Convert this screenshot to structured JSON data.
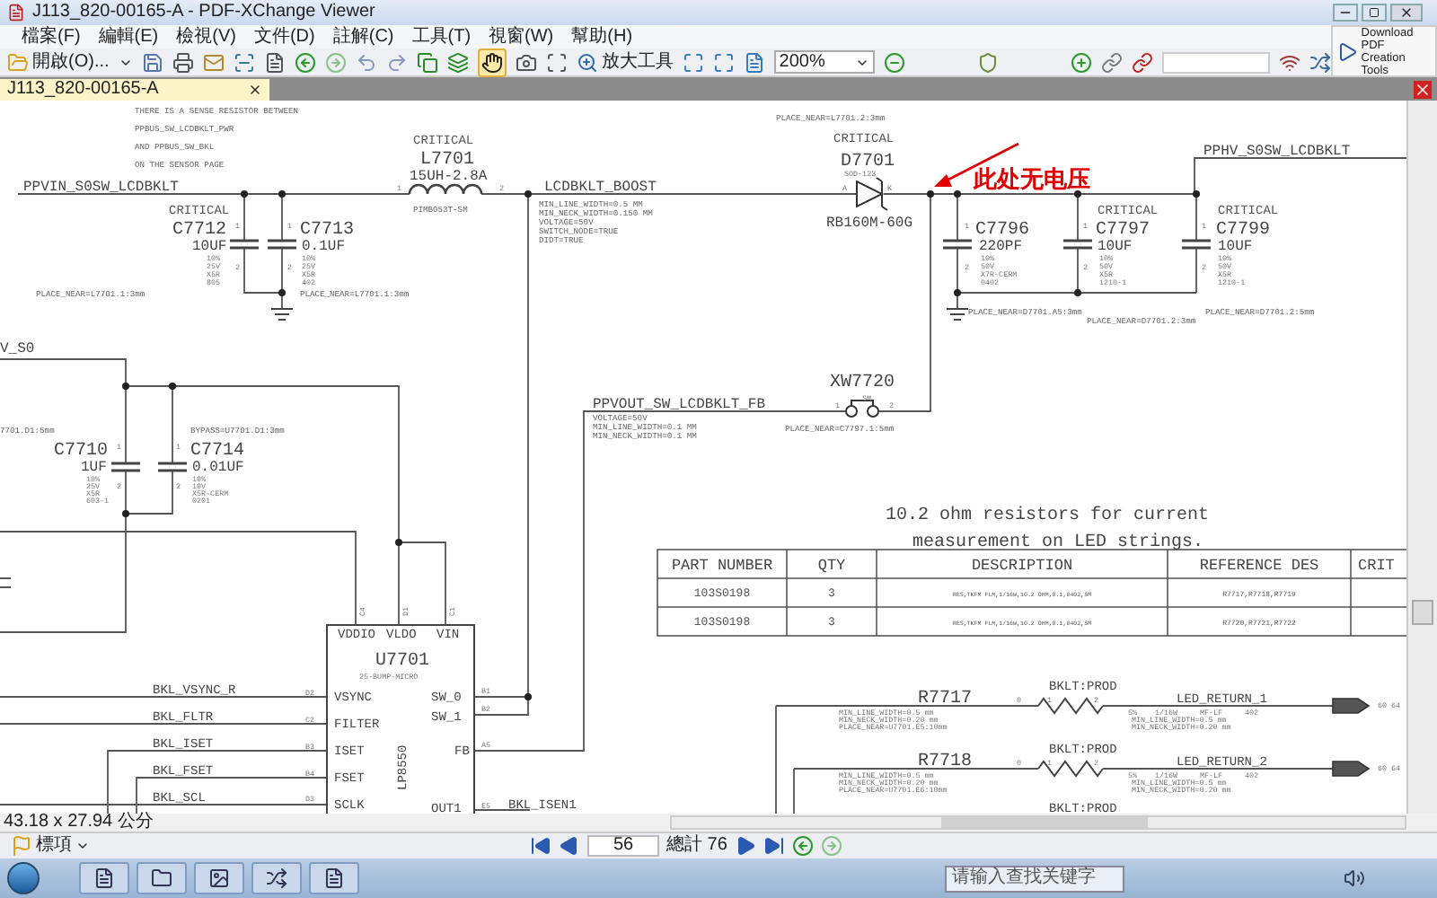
{
  "window": {
    "title": "J113_820-00165-A - PDF-XChange Viewer"
  },
  "menu": [
    "檔案(F)",
    "編輯(E)",
    "檢視(V)",
    "文件(D)",
    "註解(C)",
    "工具(T)",
    "視窗(W)",
    "幫助(H)"
  ],
  "download_button": {
    "label": "Download PDF Creation Tools"
  },
  "toolbar": {
    "open_label": "開啟(O)...",
    "zoom_tool_label": "放大工具",
    "zoom_value": "200%",
    "hand_tool": {
      "selected": true
    }
  },
  "tabs": [
    {
      "label": "J113_820-00165-A",
      "selected": true
    }
  ],
  "schematic": {
    "labels": [
      {
        "text": "THERE IS A SENSE RESISTOR BETWEEN",
        "kind": "note"
      },
      {
        "text": "PPBUS_SW_LCDBKLT_PWR",
        "kind": "note"
      },
      {
        "text": "AND PPBUS_SW_BKL",
        "kind": "note"
      },
      {
        "text": "ON THE SENSOR PAGE",
        "kind": "note"
      },
      {
        "text": "PPVIN_S0SW_LCDBKLT",
        "kind": "net"
      },
      {
        "text": "CRITICAL",
        "kind": "critical"
      },
      {
        "text": "L7701",
        "kind": "ref"
      },
      {
        "text": "15UH-2.8A",
        "kind": "value"
      },
      {
        "text": "1",
        "kind": "pin"
      },
      {
        "text": "2",
        "kind": "pin"
      },
      {
        "text": "PIMB053T-SM",
        "kind": "note"
      },
      {
        "text": "LCDBKLT_BOOST",
        "kind": "net"
      },
      {
        "text": "MIN_LINE_WIDTH=0.5 MM",
        "kind": "note"
      },
      {
        "text": "MIN_NECK_WIDTH=0.150 MM",
        "kind": "note"
      },
      {
        "text": "VOLTAGE=50V",
        "kind": "note"
      },
      {
        "text": "SWITCH_NODE=TRUE",
        "kind": "note"
      },
      {
        "text": "DIDT=TRUE",
        "kind": "note"
      },
      {
        "text": "CRITICAL",
        "kind": "critical"
      },
      {
        "text": "C7712",
        "kind": "ref"
      },
      {
        "text": "10UF",
        "kind": "value"
      },
      {
        "text": "1",
        "kind": "pin"
      },
      {
        "text": "2",
        "kind": "pin"
      },
      {
        "text": "10%",
        "kind": "spec"
      },
      {
        "text": "25V",
        "kind": "spec"
      },
      {
        "text": "X5R",
        "kind": "spec"
      },
      {
        "text": "805",
        "kind": "spec"
      },
      {
        "text": "C7713",
        "kind": "ref"
      },
      {
        "text": "0.1UF",
        "kind": "value"
      },
      {
        "text": "1",
        "kind": "pin"
      },
      {
        "text": "2",
        "kind": "pin"
      },
      {
        "text": "10%",
        "kind": "spec"
      },
      {
        "text": "25V",
        "kind": "spec"
      },
      {
        "text": "X5R",
        "kind": "spec"
      },
      {
        "text": "402",
        "kind": "spec"
      },
      {
        "text": "PLACE_NEAR=L7701.1:3mm",
        "kind": "note"
      },
      {
        "text": "PLACE_NEAR=L7701.1:3mm",
        "kind": "note"
      },
      {
        "text": "PLACE_NEAR=L7701.2:3mm",
        "kind": "note"
      },
      {
        "text": "CRITICAL",
        "kind": "critical"
      },
      {
        "text": "D7701",
        "kind": "ref"
      },
      {
        "text": "SOD-123",
        "kind": "spec"
      },
      {
        "text": "A",
        "kind": "pin"
      },
      {
        "text": "K",
        "kind": "pin"
      },
      {
        "text": "RB160M-60G",
        "kind": "value"
      },
      {
        "text": "此处无电压",
        "kind": "callout"
      },
      {
        "text": "PPHV_S0SW_LCDBKLT",
        "kind": "net"
      },
      {
        "text": "C7796",
        "kind": "ref"
      },
      {
        "text": "220PF",
        "kind": "value"
      },
      {
        "text": "1",
        "kind": "pin"
      },
      {
        "text": "2",
        "kind": "pin"
      },
      {
        "text": "10%",
        "kind": "spec"
      },
      {
        "text": "50V",
        "kind": "spec"
      },
      {
        "text": "X7R-CERM",
        "kind": "spec"
      },
      {
        "text": "0402",
        "kind": "spec"
      },
      {
        "text": "CRITICAL",
        "kind": "critical"
      },
      {
        "text": "C7797",
        "kind": "ref"
      },
      {
        "text": "10UF",
        "kind": "value"
      },
      {
        "text": "1",
        "kind": "pin"
      },
      {
        "text": "2",
        "kind": "pin"
      },
      {
        "text": "10%",
        "kind": "spec"
      },
      {
        "text": "50V",
        "kind": "spec"
      },
      {
        "text": "X5R",
        "kind": "spec"
      },
      {
        "text": "1210-1",
        "kind": "spec"
      },
      {
        "text": "CRITICAL",
        "kind": "critical"
      },
      {
        "text": "C7799",
        "kind": "ref"
      },
      {
        "text": "10UF",
        "kind": "value"
      },
      {
        "text": "1",
        "kind": "pin"
      },
      {
        "text": "2",
        "kind": "pin"
      },
      {
        "text": "10%",
        "kind": "spec"
      },
      {
        "text": "50V",
        "kind": "spec"
      },
      {
        "text": "X5R",
        "kind": "spec"
      },
      {
        "text": "1210-1",
        "kind": "spec"
      },
      {
        "text": "PLACE_NEAR=D7701.A5:3mm",
        "kind": "note"
      },
      {
        "text": "PLACE_NEAR=D7701.2:3mm",
        "kind": "note"
      },
      {
        "text": "PLACE_NEAR=D7701.2:5mm",
        "kind": "note"
      },
      {
        "text": "V_S0",
        "kind": "net"
      },
      {
        "text": "XW7720",
        "kind": "ref"
      },
      {
        "text": "SM",
        "kind": "spec"
      },
      {
        "text": "1",
        "kind": "pin"
      },
      {
        "text": "2",
        "kind": "pin"
      },
      {
        "text": "PLACE_NEAR=C7797.1:5mm",
        "kind": "note"
      },
      {
        "text": "PPVOUT_SW_LCDBKLT_FB",
        "kind": "net"
      },
      {
        "text": "VOLTAGE=50V",
        "kind": "note"
      },
      {
        "text": "MIN_LINE_WIDTH=0.1 MM",
        "kind": "note"
      },
      {
        "text": "MIN_NECK_WIDTH=0.1 MM",
        "kind": "note"
      },
      {
        "text": "7701.D1:5mm",
        "kind": "note"
      },
      {
        "text": "BYPASS=U7701.D1:3mm",
        "kind": "note"
      },
      {
        "text": "C7710",
        "kind": "ref"
      },
      {
        "text": "1UF",
        "kind": "value"
      },
      {
        "text": "1",
        "kind": "pin"
      },
      {
        "text": "2",
        "kind": "pin"
      },
      {
        "text": "10%",
        "kind": "spec"
      },
      {
        "text": "25V",
        "kind": "spec"
      },
      {
        "text": "X5R",
        "kind": "spec"
      },
      {
        "text": "603-1",
        "kind": "spec"
      },
      {
        "text": "C7714",
        "kind": "ref"
      },
      {
        "text": "0.01UF",
        "kind": "value"
      },
      {
        "text": "1",
        "kind": "pin"
      },
      {
        "text": "2",
        "kind": "pin"
      },
      {
        "text": "10%",
        "kind": "spec"
      },
      {
        "text": "10V",
        "kind": "spec"
      },
      {
        "text": "X5R-CERM",
        "kind": "spec"
      },
      {
        "text": "0201",
        "kind": "spec"
      },
      {
        "text": "10.2 ohm resistors for current",
        "kind": "heading"
      },
      {
        "text": "measurement on LED strings.",
        "kind": "heading"
      },
      {
        "text": "C4",
        "kind": "vpin"
      },
      {
        "text": "D1",
        "kind": "vpin"
      },
      {
        "text": "C1",
        "kind": "vpin"
      },
      {
        "text": "VDDIO",
        "kind": "port"
      },
      {
        "text": "VLDO",
        "kind": "port"
      },
      {
        "text": "VIN",
        "kind": "port"
      },
      {
        "text": "U7701",
        "kind": "ref"
      },
      {
        "text": "25-BUMP-MICRO",
        "kind": "spec"
      },
      {
        "text": "LP8550",
        "kind": "vertical"
      },
      {
        "text": "D2",
        "kind": "pin"
      },
      {
        "text": "C2",
        "kind": "pin"
      },
      {
        "text": "B3",
        "kind": "pin"
      },
      {
        "text": "B4",
        "kind": "pin"
      },
      {
        "text": "D3",
        "kind": "pin"
      },
      {
        "text": "VSYNC",
        "kind": "port"
      },
      {
        "text": "FILTER",
        "kind": "port"
      },
      {
        "text": "ISET",
        "kind": "port"
      },
      {
        "text": "FSET",
        "kind": "port"
      },
      {
        "text": "SCLK",
        "kind": "port"
      },
      {
        "text": "SW_0",
        "kind": "port"
      },
      {
        "text": "SW_1",
        "kind": "port"
      },
      {
        "text": "FB",
        "kind": "port"
      },
      {
        "text": "OUT1",
        "kind": "port"
      },
      {
        "text": "B1",
        "kind": "pin"
      },
      {
        "text": "B2",
        "kind": "pin"
      },
      {
        "text": "A5",
        "kind": "pin"
      },
      {
        "text": "E5",
        "kind": "pin"
      },
      {
        "text": "BKL_VSYNC_R",
        "kind": "port"
      },
      {
        "text": "BKL_FLTR",
        "kind": "port"
      },
      {
        "text": "BKL_ISET",
        "kind": "port"
      },
      {
        "text": "BKL_FSET",
        "kind": "port"
      },
      {
        "text": "BKL_SCL",
        "kind": "port"
      },
      {
        "text": "BKL_ISEN1",
        "kind": "port"
      },
      {
        "text": "BKLT:PROD",
        "kind": "port"
      },
      {
        "text": "R7717",
        "kind": "ref"
      },
      {
        "text": "0",
        "kind": "pin"
      },
      {
        "text": "1",
        "kind": "pin"
      },
      {
        "text": "2",
        "kind": "pin"
      },
      {
        "text": "LED_RETURN_1",
        "kind": "port"
      },
      {
        "text": "MIN_LINE_WIDTH=0.5 mm",
        "kind": "spec"
      },
      {
        "text": "MIN_NECK_WIDTH=0.20 mm",
        "kind": "spec"
      },
      {
        "text": "PLACE_NEAR=U7701.E5:10mm",
        "kind": "spec"
      },
      {
        "text": "5%",
        "kind": "spec"
      },
      {
        "text": "1/16W",
        "kind": "spec"
      },
      {
        "text": "MF-LF",
        "kind": "spec"
      },
      {
        "text": "402",
        "kind": "spec"
      },
      {
        "text": "MIN_LINE_WIDTH=0.5 mm",
        "kind": "spec"
      },
      {
        "text": "MIN_NECK_WIDTH=0.20 mm",
        "kind": "spec"
      },
      {
        "text": "60 64",
        "kind": "spec"
      },
      {
        "text": "BKLT:PROD",
        "kind": "port"
      },
      {
        "text": "R7718",
        "kind": "ref"
      },
      {
        "text": "0",
        "kind": "pin"
      },
      {
        "text": "1",
        "kind": "pin"
      },
      {
        "text": "2",
        "kind": "pin"
      },
      {
        "text": "LED_RETURN_2",
        "kind": "port"
      },
      {
        "text": "MIN_LINE_WIDTH=0.5 mm",
        "kind": "spec"
      },
      {
        "text": "MIN_NECK_WIDTH=0.20 mm",
        "kind": "spec"
      },
      {
        "text": "PLACE_NEAR=U7701.E6:10mm",
        "kind": "spec"
      },
      {
        "text": "5%",
        "kind": "spec"
      },
      {
        "text": "1/16W",
        "kind": "spec"
      },
      {
        "text": "MF-LF",
        "kind": "spec"
      },
      {
        "text": "402",
        "kind": "spec"
      },
      {
        "text": "MIN_LINE_WIDTH=0.5 mm",
        "kind": "spec"
      },
      {
        "text": "MIN_NECK_WIDTH=0.20 mm",
        "kind": "spec"
      },
      {
        "text": "60 64",
        "kind": "spec"
      },
      {
        "text": "BKLT:PROD",
        "kind": "port"
      }
    ],
    "table": {
      "columns": [
        "PART NUMBER",
        "QTY",
        "DESCRIPTION",
        "REFERENCE DES",
        "CRIT"
      ],
      "rows": [
        [
          "103S0198",
          "3",
          "RES,TKFM FLM,1/16W,10.2 OHM,0.1,0402,SM",
          "R7717,R7718,R7719"
        ],
        [
          "103S0198",
          "3",
          "RES,TKFM FLM,1/16W,10.2 OHM,0.1,0402,SM",
          "R7720,R7721,R7722"
        ]
      ]
    }
  },
  "status_bar": {
    "dimensions": "43.18 x 27.94 公分"
  },
  "nav_bar": {
    "bookmarks_label": "標項",
    "page": "56",
    "total": "總計 76"
  },
  "taskbar": {
    "search_placeholder": "请输入查找关键字"
  }
}
